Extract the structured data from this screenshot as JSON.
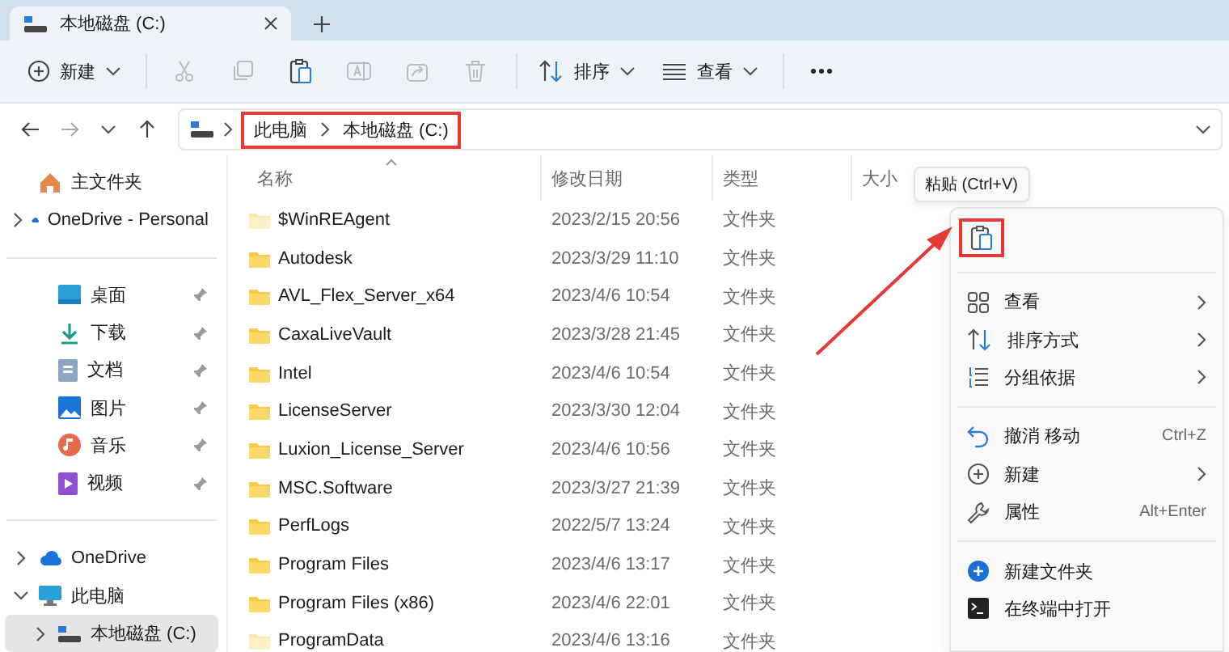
{
  "tab": {
    "title": "本地磁盘 (C:)"
  },
  "toolbar": {
    "items": [
      {
        "kind": "new",
        "label": "新建",
        "disabled": false
      },
      {
        "kind": "cut",
        "disabled": true
      },
      {
        "kind": "copy",
        "disabled": true
      },
      {
        "kind": "paste",
        "disabled": false
      },
      {
        "kind": "rename",
        "disabled": true
      },
      {
        "kind": "share",
        "disabled": true
      },
      {
        "kind": "delete",
        "disabled": true
      },
      {
        "kind": "sort",
        "label": "排序",
        "disabled": false
      },
      {
        "kind": "view",
        "label": "查看",
        "disabled": false
      },
      {
        "kind": "more"
      }
    ]
  },
  "address": {
    "highlighted": true,
    "crumbs": [
      "此电脑",
      "本地磁盘 (C:)"
    ]
  },
  "sidebar": {
    "items": [
      {
        "kind": "home",
        "label": "主文件夹",
        "expandable": false,
        "selected": false
      },
      {
        "kind": "cloud",
        "label": "OneDrive - Personal",
        "expandable": true,
        "expanded": false,
        "selected": false
      },
      {
        "kind": "divider"
      },
      {
        "kind": "desktop",
        "label": "桌面",
        "pinned": true,
        "selected": false
      },
      {
        "kind": "download",
        "label": "下载",
        "pinned": true,
        "selected": false
      },
      {
        "kind": "document",
        "label": "文档",
        "pinned": true,
        "selected": false
      },
      {
        "kind": "picture",
        "label": "图片",
        "pinned": true,
        "selected": false
      },
      {
        "kind": "music",
        "label": "音乐",
        "pinned": true,
        "selected": false
      },
      {
        "kind": "video",
        "label": "视频",
        "pinned": true,
        "selected": false
      },
      {
        "kind": "divider"
      },
      {
        "kind": "cloud",
        "label": "OneDrive",
        "expandable": true,
        "expanded": false,
        "selected": false
      },
      {
        "kind": "computer",
        "label": "此电脑",
        "expandable": true,
        "expanded": true,
        "selected": false,
        "children": [
          {
            "kind": "drive",
            "label": "本地磁盘 (C:)",
            "expandable": true,
            "expanded": false,
            "selected": true
          }
        ]
      }
    ]
  },
  "table": {
    "columns": [
      {
        "label": "名称",
        "sorted": true
      },
      {
        "label": "修改日期",
        "sorted": false
      },
      {
        "label": "类型",
        "sorted": false
      },
      {
        "label": "大小",
        "sorted": false
      }
    ],
    "rows": [
      {
        "name": "$WinREAgent",
        "date": "2023/2/15 20:56",
        "type": "文件夹",
        "hidden": true
      },
      {
        "name": "Autodesk",
        "date": "2023/3/29 11:10",
        "type": "文件夹",
        "hidden": false
      },
      {
        "name": "AVL_Flex_Server_x64",
        "date": "2023/4/6 10:54",
        "type": "文件夹",
        "hidden": false
      },
      {
        "name": "CaxaLiveVault",
        "date": "2023/3/28 21:45",
        "type": "文件夹",
        "hidden": false
      },
      {
        "name": "Intel",
        "date": "2023/4/6 10:54",
        "type": "文件夹",
        "hidden": false
      },
      {
        "name": "LicenseServer",
        "date": "2023/3/30 12:04",
        "type": "文件夹",
        "hidden": false
      },
      {
        "name": "Luxion_License_Server",
        "date": "2023/4/6 10:56",
        "type": "文件夹",
        "hidden": false
      },
      {
        "name": "MSC.Software",
        "date": "2023/3/27 21:39",
        "type": "文件夹",
        "hidden": false
      },
      {
        "name": "PerfLogs",
        "date": "2022/5/7 13:24",
        "type": "文件夹",
        "hidden": false
      },
      {
        "name": "Program Files",
        "date": "2023/4/6 13:17",
        "type": "文件夹",
        "hidden": false
      },
      {
        "name": "Program Files (x86)",
        "date": "2023/4/6 22:01",
        "type": "文件夹",
        "hidden": false
      },
      {
        "name": "ProgramData",
        "date": "2023/4/6 13:16",
        "type": "文件夹",
        "hidden": true
      }
    ]
  },
  "tooltip": {
    "text": "粘贴 (Ctrl+V)"
  },
  "context_menu": {
    "top_actions": [
      {
        "kind": "paste",
        "highlighted": true
      }
    ],
    "items": [
      {
        "kind": "view",
        "label": "查看",
        "submenu": true
      },
      {
        "kind": "sort",
        "label": "排序方式",
        "submenu": true
      },
      {
        "kind": "group",
        "label": "分组依据",
        "submenu": true
      },
      {
        "kind": "separator"
      },
      {
        "kind": "undo",
        "label": "撤消 移动",
        "shortcut": "Ctrl+Z",
        "submenu": false
      },
      {
        "kind": "new",
        "label": "新建",
        "submenu": true
      },
      {
        "kind": "properties",
        "label": "属性",
        "shortcut": "Alt+Enter",
        "submenu": false
      },
      {
        "kind": "separator"
      },
      {
        "kind": "new_folder",
        "label": "新建文件夹",
        "submenu": false
      },
      {
        "kind": "terminal",
        "label": "在终端中打开",
        "submenu": false
      }
    ]
  },
  "annotation": {
    "arrow": true
  }
}
